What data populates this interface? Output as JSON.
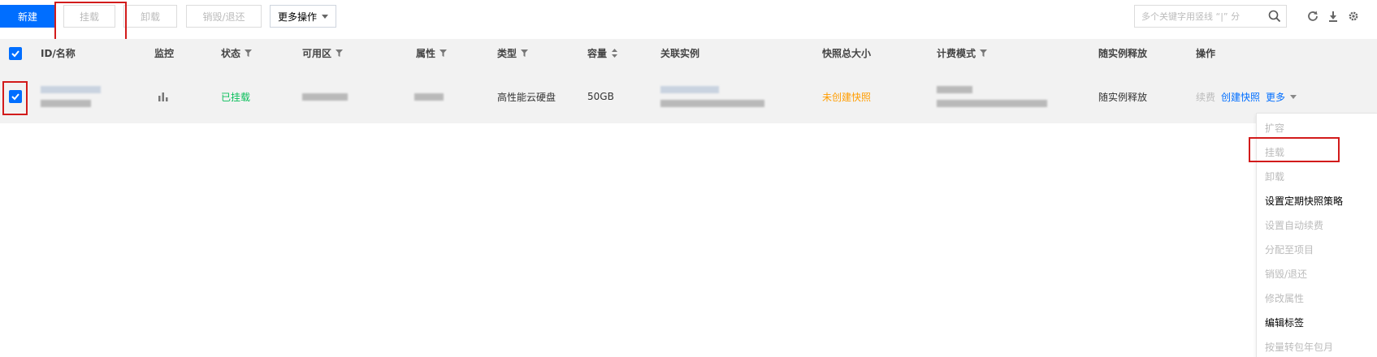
{
  "toolbar": {
    "new_label": "新建",
    "mount_label": "挂载",
    "unmount_label": "卸载",
    "destroy_label": "销毁/退还",
    "more_label": "更多操作",
    "search_placeholder": "多个关键字用竖线 “|” 分",
    "icons": [
      "search-icon",
      "refresh-icon",
      "download-icon",
      "settings-icon"
    ]
  },
  "table": {
    "columns": [
      "ID/名称",
      "监控",
      "状态",
      "可用区",
      "属性",
      "类型",
      "容量",
      "关联实例",
      "快照总大小",
      "计费模式",
      "随实例释放",
      "操作"
    ],
    "rows": [
      {
        "status": "已挂载",
        "type": "高性能云硬盘",
        "capacity": "50GB",
        "snapshot": "未创建快照",
        "release_with_instance": "随实例释放",
        "actions": {
          "renew": "续费",
          "create_snapshot": "创建快照",
          "more": "更多"
        }
      }
    ]
  },
  "dropdown_menu": [
    {
      "label": "扩容",
      "enabled": false
    },
    {
      "label": "挂载",
      "enabled": false
    },
    {
      "label": "卸载",
      "enabled": false
    },
    {
      "label": "设置定期快照策略",
      "enabled": true
    },
    {
      "label": "设置自动续费",
      "enabled": false
    },
    {
      "label": "分配至项目",
      "enabled": false
    },
    {
      "label": "销毁/退还",
      "enabled": false
    },
    {
      "label": "修改属性",
      "enabled": false
    },
    {
      "label": "编辑标签",
      "enabled": true
    },
    {
      "label": "按量转包年包月",
      "enabled": false
    }
  ],
  "colors": {
    "primary": "#006eff",
    "status_mounted": "#0abf5b",
    "snapshot_warning": "#ff9d00",
    "highlight": "#d21b1b"
  }
}
